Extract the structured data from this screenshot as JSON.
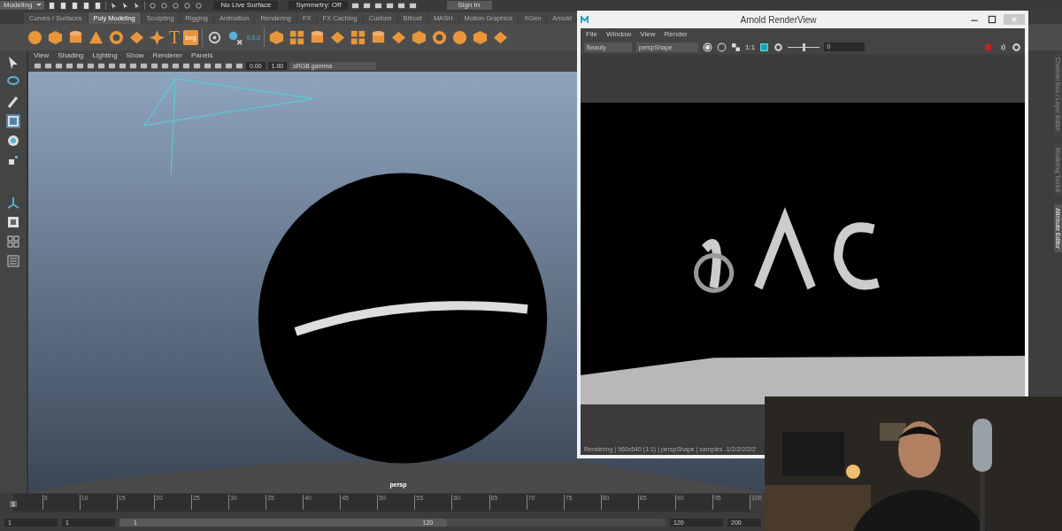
{
  "top_bar": {
    "mode": "Modeling",
    "live_surface": "No Live Surface",
    "symmetry": "Symmetry: Off",
    "sign_in": "Sign In"
  },
  "shelf_tabs": [
    {
      "label": "Curves / Surfaces",
      "selected": false
    },
    {
      "label": "Poly Modeling",
      "selected": true
    },
    {
      "label": "Sculpting",
      "selected": false
    },
    {
      "label": "Rigging",
      "selected": false
    },
    {
      "label": "Animation",
      "selected": false
    },
    {
      "label": "Rendering",
      "selected": false
    },
    {
      "label": "FX",
      "selected": false
    },
    {
      "label": "FX Caching",
      "selected": false
    },
    {
      "label": "Custom",
      "selected": false
    },
    {
      "label": "Bifrost",
      "selected": false
    },
    {
      "label": "MASH",
      "selected": false
    },
    {
      "label": "Motion Graphics",
      "selected": false
    },
    {
      "label": "XGen",
      "selected": false
    },
    {
      "label": "Arnold",
      "selected": false
    }
  ],
  "shelf": {
    "text_tool": "T",
    "svg_tool": "svg",
    "origin": "0,0,0"
  },
  "viewport": {
    "menu": [
      "View",
      "Shading",
      "Lighting",
      "Show",
      "Renderer",
      "Panels"
    ],
    "exposure": "0.00",
    "gamma": "1.00",
    "color_space": "sRGB gamma",
    "camera": "persp"
  },
  "side_tabs": [
    {
      "label": "Channel Box / Layer Editor",
      "selected": false
    },
    {
      "label": "Modeling Toolkit",
      "selected": false
    },
    {
      "label": "Attribute Editor",
      "selected": true
    }
  ],
  "timeline": {
    "ticks": [
      "5",
      "10",
      "15",
      "20",
      "25",
      "30",
      "35",
      "40",
      "45",
      "50",
      "55",
      "60",
      "65",
      "70",
      "75",
      "80",
      "85",
      "90",
      "95",
      "100"
    ],
    "current_frame": "1"
  },
  "range": {
    "level": 0.6,
    "start": "1",
    "playback_start": "1",
    "range_start": "1",
    "range_end": "120",
    "playback_end": "120",
    "end": "200"
  },
  "render_view": {
    "title": "Arnold RenderView",
    "menu": [
      "File",
      "Window",
      "View",
      "Render"
    ],
    "aov": "Beauty",
    "camera": "perspShape",
    "ratio": "1:1",
    "exposure": {
      "level": 0.5,
      "reading": "0"
    },
    "status": "Rendering | 960x540 (1:1) | perspShape  | samples -1/2/2/2/2/2"
  }
}
